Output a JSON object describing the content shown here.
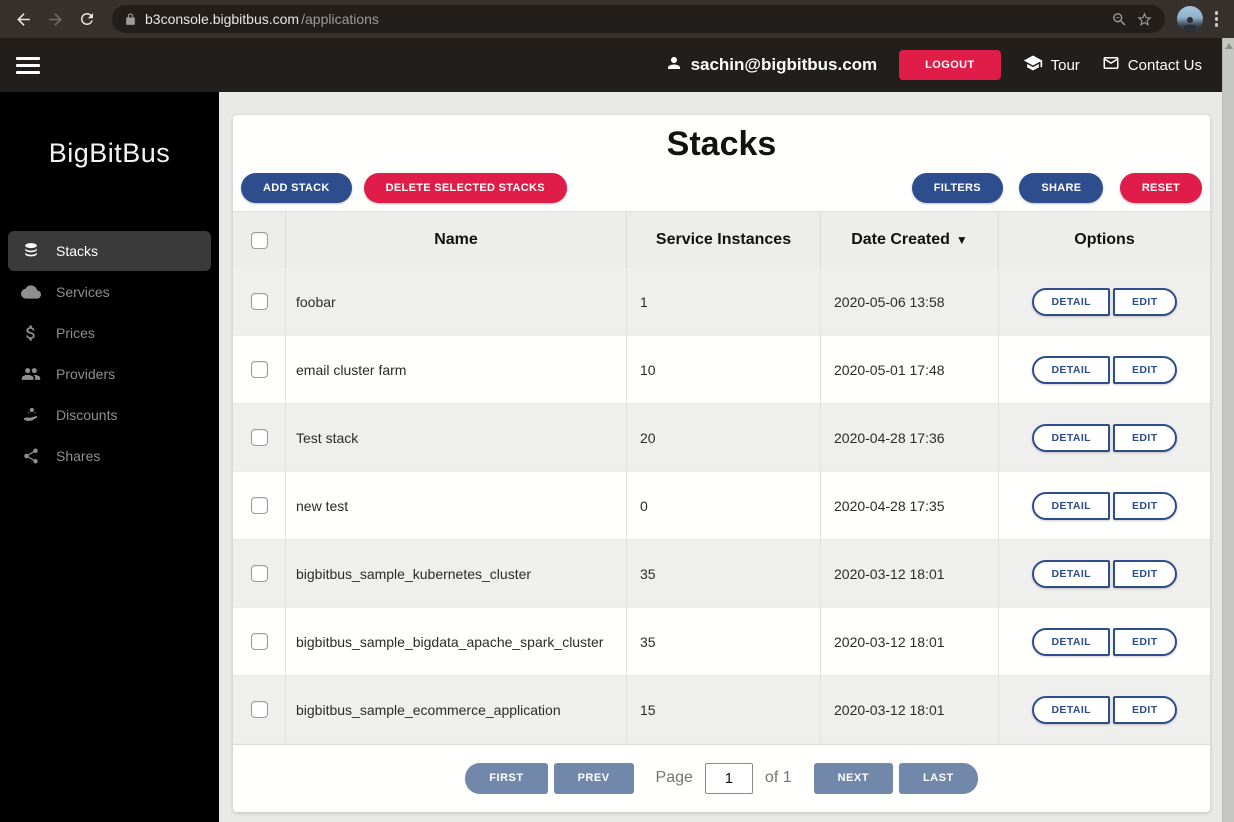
{
  "browser": {
    "url_domain": "b3console.bigbitbus.com",
    "url_path": "/applications"
  },
  "header": {
    "user_email": "sachin@bigbitbus.com",
    "logout_label": "LOGOUT",
    "tour_label": "Tour",
    "contact_label": "Contact Us"
  },
  "sidebar": {
    "logo": "BigBitBus",
    "items": [
      {
        "label": "Stacks",
        "icon": "stacks-icon",
        "active": true
      },
      {
        "label": "Services",
        "icon": "cloud-icon",
        "active": false
      },
      {
        "label": "Prices",
        "icon": "dollar-icon",
        "active": false
      },
      {
        "label": "Providers",
        "icon": "people-icon",
        "active": false
      },
      {
        "label": "Discounts",
        "icon": "discount-icon",
        "active": false
      },
      {
        "label": "Shares",
        "icon": "share-icon",
        "active": false
      }
    ]
  },
  "main": {
    "title": "Stacks",
    "toolbar": {
      "add": "ADD STACK",
      "delete": "DELETE SELECTED STACKS",
      "filters": "FILTERS",
      "share": "SHARE",
      "reset": "RESET"
    },
    "table": {
      "columns": {
        "name": "Name",
        "instances": "Service Instances",
        "created": "Date Created",
        "options": "Options"
      },
      "sort_indicator": "▼",
      "rows": [
        {
          "name": "foobar",
          "instances": "1",
          "created": "2020-05-06 13:58"
        },
        {
          "name": "email cluster farm",
          "instances": "10",
          "created": "2020-05-01 17:48"
        },
        {
          "name": "Test stack",
          "instances": "20",
          "created": "2020-04-28 17:36"
        },
        {
          "name": "new test",
          "instances": "0",
          "created": "2020-04-28 17:35"
        },
        {
          "name": "bigbitbus_sample_kubernetes_cluster",
          "instances": "35",
          "created": "2020-03-12 18:01"
        },
        {
          "name": "bigbitbus_sample_bigdata_apache_spark_cluster",
          "instances": "35",
          "created": "2020-03-12 18:01"
        },
        {
          "name": "bigbitbus_sample_ecommerce_application",
          "instances": "15",
          "created": "2020-03-12 18:01"
        }
      ],
      "row_actions": {
        "detail": "DETAIL",
        "edit": "EDIT"
      }
    },
    "pagination": {
      "first": "FIRST",
      "prev": "PREV",
      "page_label": "Page",
      "page_value": "1",
      "of_label": "of 1",
      "next": "NEXT",
      "last": "LAST"
    }
  },
  "colors": {
    "accent_navy": "#2e4d8d",
    "accent_red": "#e01c48",
    "pagination_blue": "#7288ab",
    "sidebar_bg": "#000000",
    "header_bg": "#211e1b",
    "chrome_bg": "#36312d",
    "page_bg": "#e9e9e7",
    "row_alt_bg": "#efefed"
  }
}
